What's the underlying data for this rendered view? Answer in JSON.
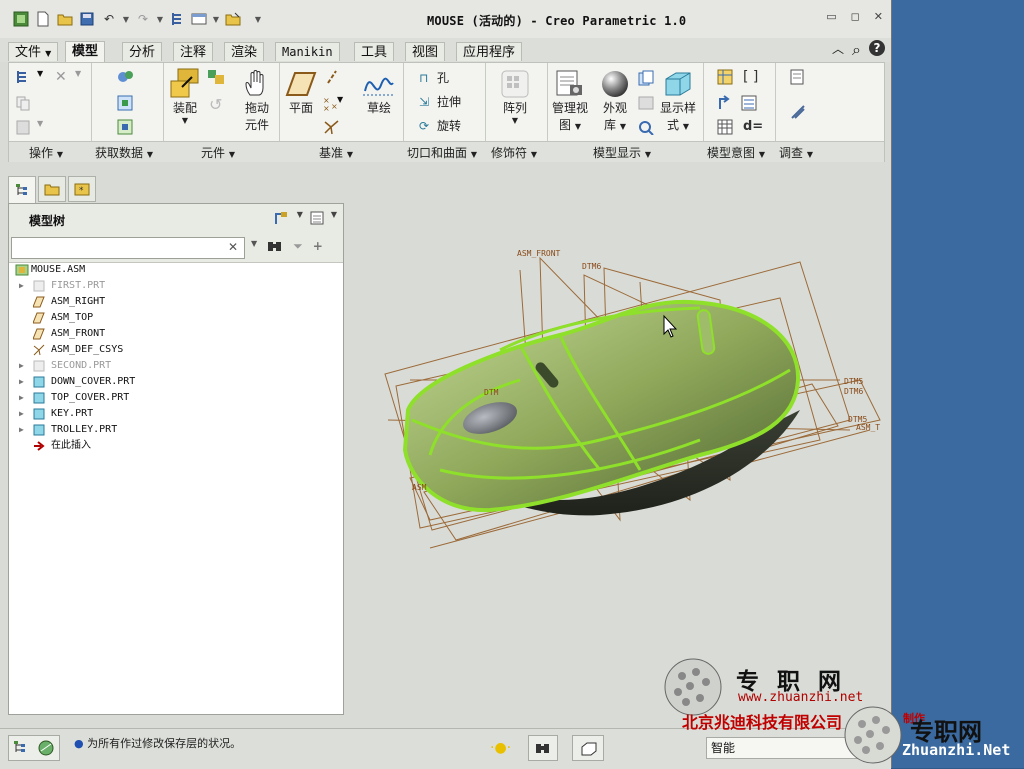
{
  "title": "MOUSE (活动的) - Creo Parametric 1.0",
  "quick_access": [
    "new-icon",
    "open-icon",
    "save-icon",
    "undo-icon",
    "redo-icon",
    "regenerate-icon",
    "windows-icon",
    "close-window-icon",
    "customize-icon"
  ],
  "window_controls": [
    "minimize",
    "restore",
    "close"
  ],
  "tabs": [
    {
      "label": "文件",
      "state": "file"
    },
    {
      "label": "模型",
      "state": "active"
    },
    {
      "label": "分析"
    },
    {
      "label": "注释"
    },
    {
      "label": "渲染"
    },
    {
      "label": "Manikin"
    },
    {
      "label": "工具"
    },
    {
      "label": "视图"
    },
    {
      "label": "应用程序"
    }
  ],
  "ribbon": {
    "buttons": {
      "assemble": "装配",
      "drag": "拖动\n元件",
      "plane": "平面",
      "sketch": "草绘",
      "hole": "孔",
      "extrude": "拉伸",
      "revolve": "旋转",
      "pattern": "阵列",
      "manage_views": "管理视\n图",
      "appearance": "外观\n库",
      "display_style": "显示样\n式",
      "drag_l1": "拖动",
      "drag_l2": "元件",
      "manage_l1": "管理视",
      "manage_l2": "图",
      "appearance_l1": "外观",
      "appearance_l2": "库",
      "display_l1": "显示样",
      "display_l2": "式"
    },
    "groups": [
      "操作",
      "获取数据",
      "元件",
      "基准",
      "切口和曲面",
      "修饰符",
      "模型显示",
      "模型意图",
      "调查"
    ],
    "accent_color": "#c9a227"
  },
  "graphics_toolbar": [
    "refit-icon",
    "zoom-in-icon",
    "zoom-out-icon",
    "repaint-icon",
    "display-style-icon",
    "saved-views-icon",
    "view-manager-icon",
    "datum-display-icon",
    "spin-center-icon",
    "annotation-icon"
  ],
  "left_tabs": [
    "model-tree-tab",
    "folder-browser-tab",
    "favorites-tab"
  ],
  "model_tree": {
    "title": "模型树",
    "search_placeholder": "",
    "items": [
      {
        "label": "MOUSE.ASM",
        "type": "asm",
        "level": 0
      },
      {
        "label": "FIRST.PRT",
        "type": "part-dim",
        "expandable": true
      },
      {
        "label": "ASM_RIGHT",
        "type": "plane"
      },
      {
        "label": "ASM_TOP",
        "type": "plane"
      },
      {
        "label": "ASM_FRONT",
        "type": "plane"
      },
      {
        "label": "ASM_DEF_CSYS",
        "type": "csys"
      },
      {
        "label": "SECOND.PRT",
        "type": "part-dim",
        "expandable": true
      },
      {
        "label": "DOWN_COVER.PRT",
        "type": "part",
        "expandable": true
      },
      {
        "label": "TOP_COVER.PRT",
        "type": "part",
        "expandable": true
      },
      {
        "label": "KEY.PRT",
        "type": "part",
        "expandable": true
      },
      {
        "label": "TROLLEY.PRT",
        "type": "part",
        "expandable": true
      },
      {
        "label": "在此插入",
        "type": "insert"
      }
    ]
  },
  "viewport_labels": {
    "asm_front": "ASM_FRONT",
    "dtm6_top": "DTM6",
    "dtm5_right": "DTM5",
    "dtm6_right": "DTM6",
    "dtm5_right2": "DTM5",
    "asm_t": "ASM_T",
    "dtm_left": "DTM",
    "asm_left": "ASM"
  },
  "status": {
    "message": "为所有作过修改保存层的状况。",
    "filter_value": "智能"
  },
  "watermark": {
    "cn_name": "专职网",
    "url": "www.zhuanzhi.net",
    "company": "北京兆迪科技有限公司",
    "cn_name2": "专职网",
    "url2": "Zhuanzhi.Net",
    "stamp": "制作"
  }
}
